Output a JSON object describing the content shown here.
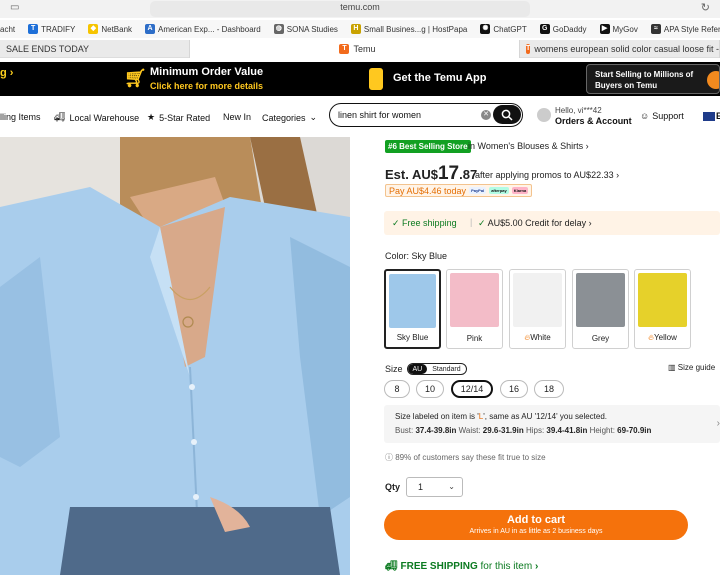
{
  "browser": {
    "url": "temu.com",
    "bookmarks": [
      {
        "label": "acht",
        "color": "#555"
      },
      {
        "label": "TRADIFY",
        "color": "#1d6fd8"
      },
      {
        "label": "NetBank",
        "color": "#f6c400"
      },
      {
        "label": "American Exp... - Dashboard",
        "color": "#2e6ec8"
      },
      {
        "label": "SONA Studies",
        "color": "#444"
      },
      {
        "label": "Small Busines...g | HostPapa",
        "color": "#c9a200"
      },
      {
        "label": "ChatGPT",
        "color": "#111"
      },
      {
        "label": "GoDaddy",
        "color": "#111"
      },
      {
        "label": "MyGov",
        "color": "#111"
      },
      {
        "label": "APA Style Referencing",
        "color": "#333"
      }
    ],
    "tabs": [
      {
        "label": "SALE ENDS TODAY"
      },
      {
        "label": "Temu"
      },
      {
        "label": "womens european solid color casual loose fit -"
      }
    ]
  },
  "promo": {
    "left": "g",
    "min_order_title": "Minimum Order Value",
    "min_order_sub": "Click here for more details",
    "app_label": "Get the Temu App",
    "sell_line1": "Start Selling to Millions of",
    "sell_line2": "Buyers on Temu"
  },
  "nav": {
    "best_selling": "lling Items",
    "local_warehouse": "Local Warehouse",
    "five_star": "5-Star Rated",
    "new_in": "New In",
    "categories": "Categories",
    "search_value": "linen shirt for women",
    "hello": "Hello, vi***42",
    "orders": "Orders & Account",
    "support": "Support",
    "region": "E"
  },
  "product": {
    "badge": "#6 Best Selling Store",
    "badge_tail": "in Women's Blouses & Shirts",
    "price_prefix": "Est. AU$",
    "price_int": "17",
    "price_dec": ".87",
    "price_note": "after applying promos to AU$22.33",
    "pay_today": "Pay AU$4.46 today",
    "pay_methods": [
      "PayPal",
      "afterpay",
      "Klarna"
    ],
    "free_ship": "Free shipping",
    "credit": "AU$5.00 Credit for delay",
    "color_label": "Color: Sky Blue",
    "colors": [
      {
        "name": "Sky Blue",
        "hex": "#9ec8ea",
        "hot": false
      },
      {
        "name": "Pink",
        "hex": "#f3bcc8",
        "hot": false
      },
      {
        "name": "White",
        "hex": "#f1f1f1",
        "hot": true
      },
      {
        "name": "Grey",
        "hex": "#8b9095",
        "hot": false
      },
      {
        "name": "Yellow",
        "hex": "#e6d12a",
        "hot": true
      }
    ],
    "size_label": "Size",
    "size_systems": [
      "AU",
      "Standard"
    ],
    "size_guide": "Size guide",
    "sizes": [
      "8",
      "10",
      "12/14",
      "16",
      "18"
    ],
    "size_info_a": "Size labeled on item is '",
    "size_info_l": "L",
    "size_info_b": "', same as AU '12/14' you selected.",
    "bust_label": "Bust:",
    "bust": "37.4-39.8in",
    "waist_label": "Waist:",
    "waist": "29.6-31.9in",
    "hips_label": "Hips:",
    "hips": "39.4-41.8in",
    "height_label": "Height:",
    "height": "69-70.9in",
    "fit_note": "89% of customers say these fit true to size",
    "qty_label": "Qty",
    "qty_value": "1",
    "cta": "Add to cart",
    "cta_sub": "Arrives in AU in as little as 2 business days",
    "free_shipping_a": "FREE SHIPPING",
    "free_shipping_b": "for this item"
  }
}
